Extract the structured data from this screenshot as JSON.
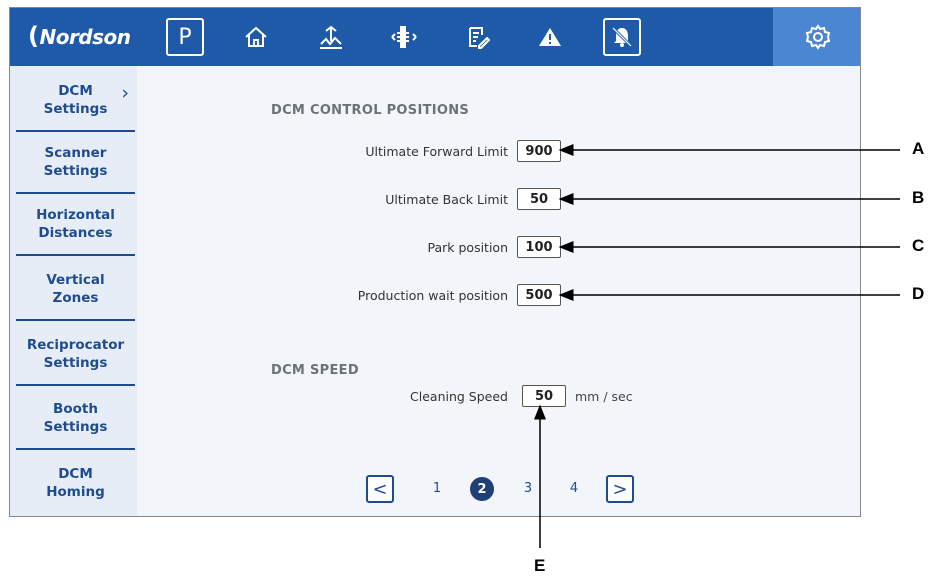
{
  "brand": {
    "logo_text": "Nordson"
  },
  "topbar": {
    "icons": [
      {
        "name": "parking-icon",
        "glyph": "P"
      },
      {
        "name": "home-icon"
      },
      {
        "name": "gun-mover-icon"
      },
      {
        "name": "reciprocator-icon"
      },
      {
        "name": "recipe-edit-icon"
      },
      {
        "name": "warning-icon"
      },
      {
        "name": "alarm-muted-icon"
      },
      {
        "name": "settings-gear-icon",
        "active": true
      }
    ]
  },
  "sidebar": {
    "items": [
      {
        "label": "DCM\nSettings",
        "active": true
      },
      {
        "label": "Scanner\nSettings"
      },
      {
        "label": "Horizontal\nDistances"
      },
      {
        "label": "Vertical\nZones"
      },
      {
        "label": "Reciprocator\nSettings"
      },
      {
        "label": "Booth\nSettings"
      },
      {
        "label": "DCM\nHoming"
      }
    ]
  },
  "control_positions": {
    "title": "DCM CONTROL POSITIONS",
    "rows": [
      {
        "label": "Ultimate Forward Limit",
        "value": "900"
      },
      {
        "label": "Ultimate Back Limit",
        "value": "50"
      },
      {
        "label": "Park position",
        "value": "100"
      },
      {
        "label": "Production wait position",
        "value": "500"
      }
    ]
  },
  "speed": {
    "title": "DCM SPEED",
    "label": "Cleaning Speed",
    "value": "50",
    "unit": "mm / sec"
  },
  "pagination": {
    "prev": "<",
    "next": ">",
    "pages": [
      "1",
      "2",
      "3",
      "4"
    ],
    "current": "2"
  },
  "callouts": [
    "A",
    "B",
    "C",
    "D",
    "E"
  ],
  "colors": {
    "topbar": "#1f5aa8",
    "active_tile": "#4b86d2",
    "nav_text": "#1f4c8f"
  }
}
